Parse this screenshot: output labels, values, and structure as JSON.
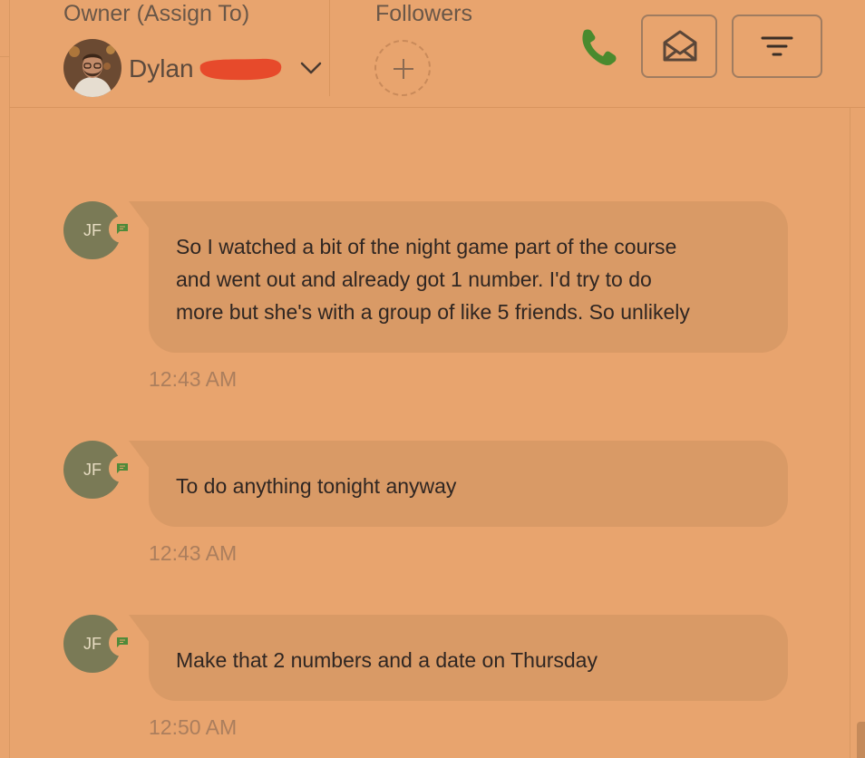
{
  "header": {
    "owner_label": "Owner (Assign To)",
    "owner_name": "Dylan",
    "followers_label": "Followers"
  },
  "colors": {
    "background": "#e8a46e",
    "bubble": "#d99a66",
    "avatar": "#7a7a56",
    "phone": "#4a8a2e",
    "redaction": "#e74a2b"
  },
  "icons": {
    "chevron": "chevron-down-icon",
    "add_follower": "plus-icon",
    "phone": "phone-icon",
    "mail": "envelope-open-icon",
    "filter": "filter-lines-icon",
    "channel": "sms-chat-icon"
  },
  "messages": [
    {
      "initials": "JF",
      "lines": [
        "So I watched a bit of the night game part of the course",
        "and went out and already got 1 number. I'd try to do",
        "more but she's with a group of like 5 friends. So unlikely"
      ],
      "time": "12:43 AM"
    },
    {
      "initials": "JF",
      "lines": [
        "To do anything tonight anyway"
      ],
      "time": "12:43 AM"
    },
    {
      "initials": "JF",
      "lines": [
        "Make that 2 numbers and a date on Thursday"
      ],
      "time": "12:50 AM"
    }
  ]
}
